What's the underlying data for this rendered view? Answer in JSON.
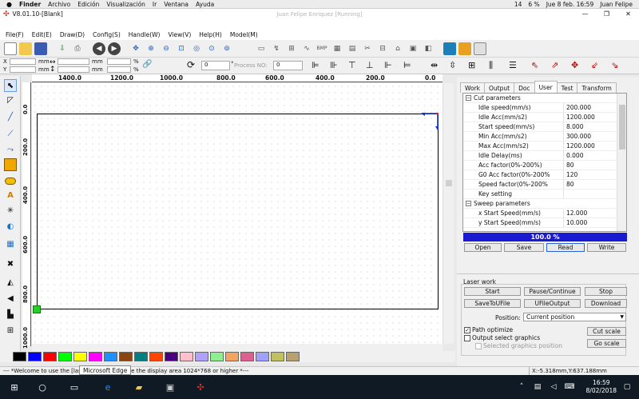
{
  "macbar": {
    "app": "Finder",
    "menus": [
      "Archivo",
      "Edición",
      "Visualización",
      "Ir",
      "Ventana",
      "Ayuda"
    ],
    "right": [
      "14",
      "6 %",
      "Jue 8 feb.  16:59",
      "Juan Felipe"
    ]
  },
  "window": {
    "title": "V8.01.10-[Blank]",
    "center_title": "Juan Felipe Enriquez [Running]"
  },
  "menubar": [
    "File(F)",
    "Edit(E)",
    "Draw(D)",
    "Config(S)",
    "Handle(W)",
    "View(V)",
    "Help(H)",
    "Model(M)"
  ],
  "coords": {
    "x_label": "X",
    "y_label": "Y",
    "x_value": "0",
    "y_value": "0",
    "unit": "mm",
    "pct": "%",
    "w_value": "0",
    "h_value": "0",
    "rotate_value": "0",
    "process_no_label": "Process NO:",
    "process_no_value": "0",
    "w_pct": "100",
    "h_pct": "100"
  },
  "hruler": [
    "1400.0",
    "1200.0",
    "1000.0",
    "800.0",
    "600.0",
    "400.0",
    "200.0",
    "0.0"
  ],
  "vruler": [
    "0.0",
    "200.0",
    "400.0",
    "600.0",
    "800.0",
    "1000.0"
  ],
  "palette": [
    "#000000",
    "#0000ff",
    "#ff0000",
    "#00ff00",
    "#ffff00",
    "#ff00ff",
    "#1e90ff",
    "#8b4513",
    "#008080",
    "#ff4500",
    "#4b0082",
    "#ffc0cb",
    "#b0a0ff",
    "#90ee90",
    "#f4a460",
    "#dc6090",
    "#a0a0ff",
    "#c0c060",
    "#b8a070"
  ],
  "tabs": [
    {
      "label": "Work",
      "active": false
    },
    {
      "label": "Output",
      "active": false
    },
    {
      "label": "Doc",
      "active": false
    },
    {
      "label": "User",
      "active": true
    },
    {
      "label": "Test",
      "active": false
    },
    {
      "label": "Transform",
      "active": false
    }
  ],
  "params": [
    {
      "type": "group",
      "label": "Cut parameters"
    },
    {
      "label": "Idle speed(mm/s)",
      "value": "200.000"
    },
    {
      "label": "Idle Acc(mm/s2)",
      "value": "1200.000"
    },
    {
      "label": "Start speed(mm/s)",
      "value": "8.000"
    },
    {
      "label": "Min Acc(mm/s2)",
      "value": "300.000"
    },
    {
      "label": "Max Acc(mm/s2)",
      "value": "1200.000"
    },
    {
      "label": "Idle Delay(ms)",
      "value": "0.000"
    },
    {
      "label": "Acc factor(0%-200%)",
      "value": "80"
    },
    {
      "label": "G0 Acc factor(0%-200%",
      "value": "120"
    },
    {
      "label": "Speed factor(0%-200%",
      "value": "80"
    },
    {
      "label": "Key setting",
      "value": ""
    },
    {
      "type": "group",
      "label": "Sweep parameters"
    },
    {
      "label": "x Start Speed(mm/s)",
      "value": "12.000"
    },
    {
      "label": "y Start Speed(mm/s)",
      "value": "10.000"
    }
  ],
  "progress": {
    "text": "100.0  %",
    "fraction": 1.0
  },
  "param_buttons": [
    "Open",
    "Save",
    "Read",
    "Write"
  ],
  "laser_work": {
    "label": "Laser work",
    "buttons_row1": [
      "Start",
      "Pause/Continue",
      "Stop"
    ],
    "buttons_row2": [
      "SaveToUFile",
      "UFileOutput",
      "Download"
    ],
    "position_label": "Position:",
    "position_value": "Current position",
    "path_optimize": "Path optimize",
    "output_select": "Output select graphics",
    "selected_graphics": "Selected graphics position",
    "cut_scale": "Cut scale",
    "go_scale": "Go scale"
  },
  "status": {
    "message": "--- *Welcome to use the [laser] cutting,Propose the display area 1024*768 or higher *---",
    "position": "X:-5.318mm,Y:637.188mm"
  },
  "tooltip": "Microsoft Edge",
  "taskbar": {
    "time": "16:59",
    "date": "8/02/2018"
  }
}
